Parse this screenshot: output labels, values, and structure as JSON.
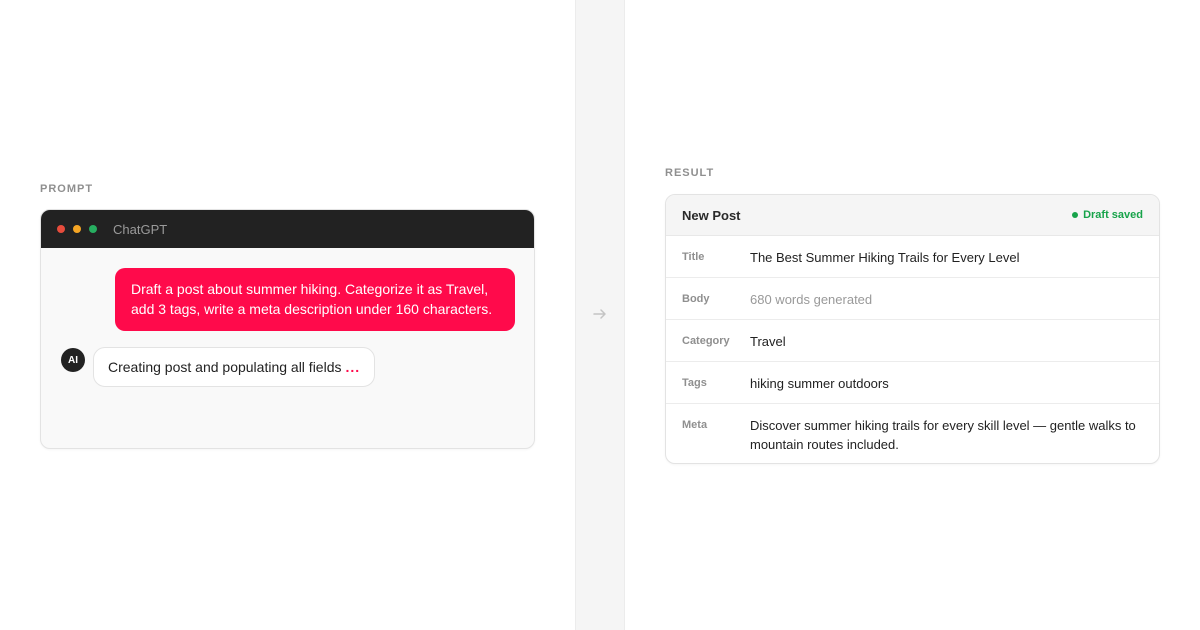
{
  "prompt_section": {
    "label": "PROMPT",
    "window_title": "ChatGPT",
    "traffic_lights": {
      "close": "#e74c3c",
      "minimize": "#f5a524",
      "maximize": "#27ae60"
    },
    "user_message": "Draft a post about summer hiking. Categorize it as Travel, add 3 tags, write a meta description under 160 characters.",
    "ai_avatar": "AI",
    "ai_message": "Creating post and populating all fields",
    "ai_dots": "..."
  },
  "result_section": {
    "label": "RESULT",
    "card_title": "New Post",
    "status": "Draft saved",
    "fields": [
      {
        "label": "Title",
        "value": "The Best Summer Hiking Trails for Every Level"
      },
      {
        "label": "Body",
        "value": "680 words generated"
      },
      {
        "label": "Category",
        "value": "Travel"
      },
      {
        "label": "Tags",
        "value": "hiking summer outdoors"
      },
      {
        "label": "Meta",
        "value": "Discover summer hiking trails for every skill level — gentle walks to mountain routes included."
      }
    ]
  },
  "colors": {
    "accent": "#ff0a4b",
    "success": "#17a34a",
    "dark": "#222222"
  },
  "icons": {
    "transition": "arrow-right-icon",
    "status": "status-dot-icon"
  }
}
